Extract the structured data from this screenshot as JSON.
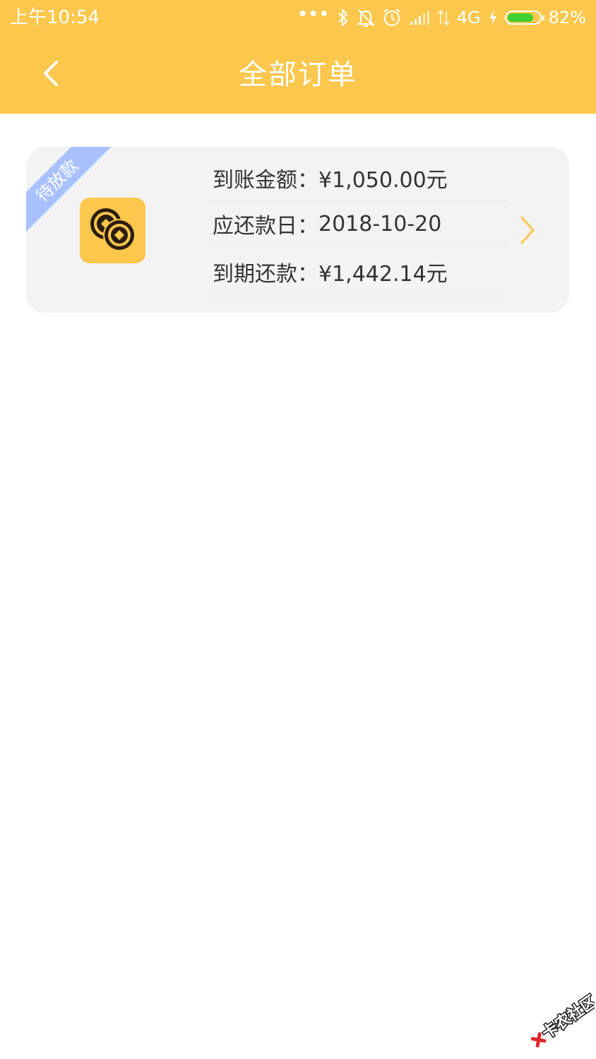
{
  "status_bar": {
    "time": "上午10:54",
    "dots": "•••",
    "network": "4G",
    "battery_percent": "82%",
    "battery_level": 0.82,
    "icons": [
      "bluetooth-icon",
      "mute-icon",
      "alarm-icon",
      "signal-icon",
      "data-arrows-icon",
      "charging-icon",
      "battery-icon"
    ]
  },
  "header": {
    "title": "全部订单",
    "back_icon": "chevron-left-icon",
    "background_color": "#fbc74d"
  },
  "order": {
    "status_badge": "待放款",
    "badge_color": "#a9c2ff",
    "icon": "coins-icon",
    "rows": [
      {
        "label": "到账金额：",
        "value": "¥1,050.00元"
      },
      {
        "label": "应还款日：",
        "value": "2018-10-20"
      },
      {
        "label": "到期还款：",
        "value": "¥1,442.14元"
      }
    ],
    "chevron_icon": "chevron-right-icon",
    "chevron_color": "#fbc74d"
  },
  "watermark": {
    "text": "卡农社区"
  }
}
